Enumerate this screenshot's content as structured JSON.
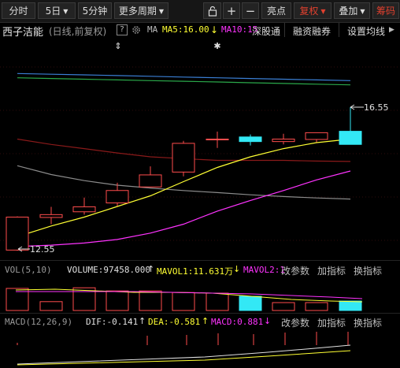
{
  "toolbar": {
    "tabs": [
      "分时",
      "5日",
      "5分钟",
      "更多周期"
    ],
    "lock": "🔒",
    "plus": "+",
    "minus": "−",
    "highlight": "亮点",
    "fuquan": "复权",
    "overlay": "叠加",
    "chips": "筹码"
  },
  "info": {
    "stock_name": "西子洁能",
    "period": "(日线,前复权)",
    "help": "?",
    "ma_label": "MA",
    "ma5": "MA5:16.00",
    "ma5_arrow": "↓",
    "ma10": "MA10:15",
    "shengutong": "深股通",
    "rongzi": "融资融券",
    "settings": "设置均线"
  },
  "kline": {
    "high_label": "16.55",
    "low_label": "12.55",
    "colors": {
      "up": "#ff4d4d",
      "down": "#33e8f5",
      "ma5": "#ffff33",
      "ma10": "#ff33ff",
      "ma20": "#8a1a1a",
      "ma60": "#8c8c8c",
      "ma_blue": "#3a7fd5",
      "ma_green": "#2aa84a"
    },
    "candles": [
      {
        "o": 12.52,
        "c": 13.45,
        "h": 13.47,
        "l": 12.5
      },
      {
        "o": 13.44,
        "c": 13.52,
        "h": 13.74,
        "l": 13.25
      },
      {
        "o": 13.6,
        "c": 13.74,
        "h": 14.0,
        "l": 13.52
      },
      {
        "o": 13.85,
        "c": 14.2,
        "h": 14.42,
        "l": 13.76
      },
      {
        "o": 14.3,
        "c": 14.64,
        "h": 14.88,
        "l": 14.3
      },
      {
        "o": 14.72,
        "c": 15.53,
        "h": 15.6,
        "l": 14.6
      },
      {
        "o": 15.65,
        "c": 15.65,
        "h": 15.86,
        "l": 15.4
      },
      {
        "o": 15.71,
        "c": 15.58,
        "h": 15.78,
        "l": 15.47
      },
      {
        "o": 15.58,
        "c": 15.65,
        "h": 15.8,
        "l": 15.5
      },
      {
        "o": 15.64,
        "c": 15.83,
        "h": 15.84,
        "l": 15.56
      },
      {
        "o": 15.87,
        "c": 15.5,
        "h": 16.55,
        "l": 15.5
      }
    ],
    "ma5": [
      12.9,
      13.2,
      13.45,
      13.75,
      14.05,
      14.45,
      14.85,
      15.15,
      15.38,
      15.55,
      15.65
    ],
    "ma10": [
      12.62,
      12.66,
      12.72,
      12.82,
      13.0,
      13.25,
      13.62,
      13.92,
      14.2,
      14.5,
      14.75
    ],
    "ma20": [
      15.65,
      15.5,
      15.38,
      15.26,
      15.15,
      15.1,
      15.05,
      15.05,
      15.05,
      15.03,
      15.02
    ],
    "ma60": [
      14.9,
      14.65,
      14.48,
      14.35,
      14.27,
      14.2,
      14.14,
      14.08,
      14.03,
      13.99,
      13.96
    ],
    "ma_blue": [
      17.5,
      17.48,
      17.46,
      17.44,
      17.42,
      17.4,
      17.38,
      17.36,
      17.34,
      17.32,
      17.3
    ],
    "ma_green": [
      17.38,
      17.36,
      17.34,
      17.32,
      17.3,
      17.28,
      17.26,
      17.24,
      17.22,
      17.2,
      17.18
    ],
    "marker1": "⇕",
    "marker2": "✱"
  },
  "volume": {
    "title": "VOL(5,10)",
    "volume_label": "VOLUME:97458.000",
    "up_arrow": "↑",
    "mavol1": "MAVOL1:11.631万",
    "mavol1_arrow": "↓",
    "mavol2": "MAVOL2:1",
    "params": "改参数",
    "add": "加指标",
    "switch": "换指标",
    "bars": [
      0.7,
      0.28,
      0.72,
      0.62,
      0.62,
      0.57,
      0.55,
      0.45,
      0.25,
      0.25,
      0.3
    ]
  },
  "macd": {
    "title": "MACD(12,26,9)",
    "dif": "DIF:-0.141",
    "dif_arrow": "↑",
    "dea": "DEA:-0.581",
    "dea_arrow": "↑",
    "macd": "MACD:0.881",
    "macd_arrow": "↓",
    "params": "改参数",
    "add": "加指标",
    "switch": "换指标"
  }
}
